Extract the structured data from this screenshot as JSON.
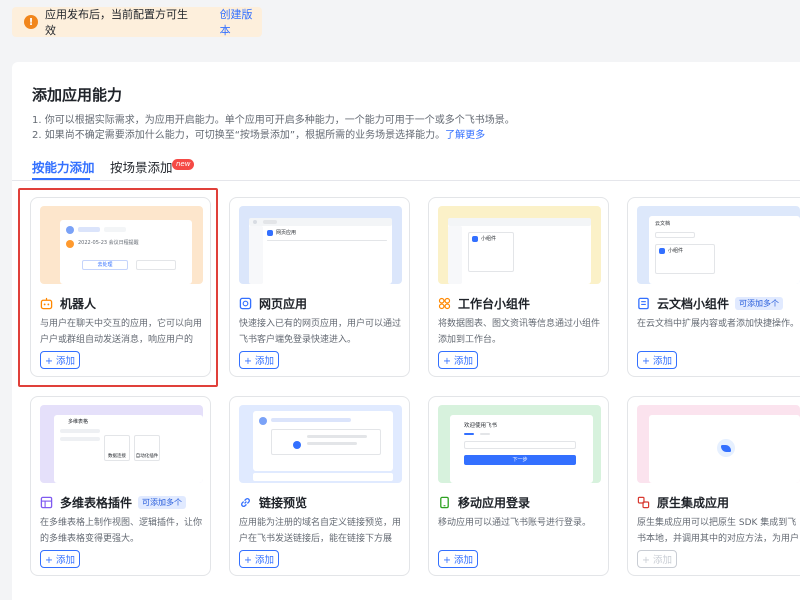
{
  "notice": {
    "text": "应用发布后，当前配置方可生效",
    "link": "创建版本"
  },
  "section": {
    "title": "添加应用能力",
    "desc1": "1. 你可以根据实际需求，为应用开启能力。单个应用可开启多种能力，一个能力可用于一个或多个飞书场景。",
    "desc2": "2. 如果尚不确定需要添加什么能力，可切换至“按场景添加”，根据所需的业务场景选择能力。",
    "desc2_link": "了解更多"
  },
  "tabs": [
    {
      "label": "按能力添加",
      "active": true
    },
    {
      "label": "按场景添加",
      "badge": "new"
    }
  ],
  "cards": [
    {
      "title": "机器人",
      "desc": "与用户在聊天中交互的应用，它可以向用户户或群组自动发送消息，响应用户的消...",
      "add": "+ 添加",
      "icon": "robot-icon",
      "tag": ""
    },
    {
      "title": "网页应用",
      "desc": "快速接入已有的网页应用，用户可以通过飞书客户端免登录快速进入。",
      "add": "+ 添加",
      "icon": "web-icon",
      "tag": ""
    },
    {
      "title": "工作台小组件",
      "desc": "将数据图表、图文资讯等信息通过小组件添加到工作台。",
      "add": "+ 添加",
      "icon": "widget-icon",
      "tag": ""
    },
    {
      "title": "云文档小组件",
      "desc": "在云文档中扩展内容或者添加快捷操作。",
      "add": "+ 添加",
      "icon": "doc-icon",
      "tag": "可添加多个"
    },
    {
      "title": "多维表格插件",
      "desc": "在多维表格上制作视图、逻辑插件，让你的多维表格变得更强大。",
      "add": "+ 添加",
      "icon": "bitable-icon",
      "tag": "可添加多个"
    },
    {
      "title": "链接预览",
      "desc": "应用能为注册的域名自定义链接预览，用户在飞书发送链接后，能在链接下方展示...",
      "add": "+ 添加",
      "icon": "link-icon",
      "tag": ""
    },
    {
      "title": "移动应用登录",
      "desc": "移动应用可以通过飞书账号进行登录。",
      "add": "+ 添加",
      "icon": "mobile-icon",
      "tag": ""
    },
    {
      "title": "原生集成应用",
      "desc": "原生集成应用可以把原生 SDK 集成到飞书本地，并调用其中的对应方法，为用户提...",
      "add": "+ 添加",
      "icon": "native-icon",
      "tag": "",
      "disabled": true
    }
  ],
  "thumbs": {
    "robot_line1": "2022-05-23 会议日程提醒",
    "robot_btn": "去处理",
    "web_title": "网页应用",
    "widget_title": "小组件",
    "doc_title": "云文档",
    "doc_item": "小组件",
    "bitable_title": "多维表格",
    "bitable_btn1": "数据连接",
    "bitable_btn2": "自动化插件",
    "mobile_title": "欢迎使用飞书",
    "mobile_btn": "下一步"
  },
  "colors": {
    "accent": "#3370ff",
    "highlight": "#e0403a"
  }
}
